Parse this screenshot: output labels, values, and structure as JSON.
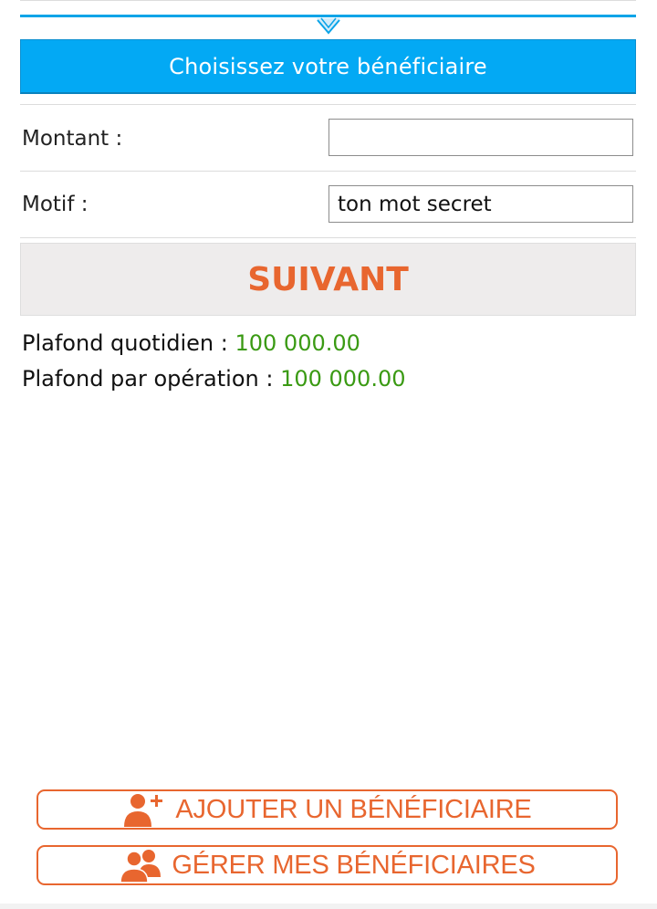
{
  "beneficiary": {
    "choose_label": "Choisissez votre bénéficiaire"
  },
  "form": {
    "amount_label": "Montant :",
    "amount_value": "",
    "reason_label": "Motif :",
    "reason_value": "ton mot secret"
  },
  "next_button": {
    "label": "SUIVANT"
  },
  "limits": {
    "daily_label": "Plafond quotidien : ",
    "daily_value": "100 000.00",
    "per_operation_label": "Plafond par opération : ",
    "per_operation_value": "100 000.00"
  },
  "actions": {
    "add_beneficiary": {
      "label": "AJOUTER UN BÉNÉFICIAIRE",
      "icon": "add-user-icon"
    },
    "manage_beneficiaries": {
      "label": "GÉRER MES BÉNÉFICIAIRES",
      "icon": "users-icon"
    }
  },
  "colors": {
    "accent_blue": "#03a9f4",
    "accent_orange": "#e8662f",
    "value_green": "#3a9a13"
  }
}
